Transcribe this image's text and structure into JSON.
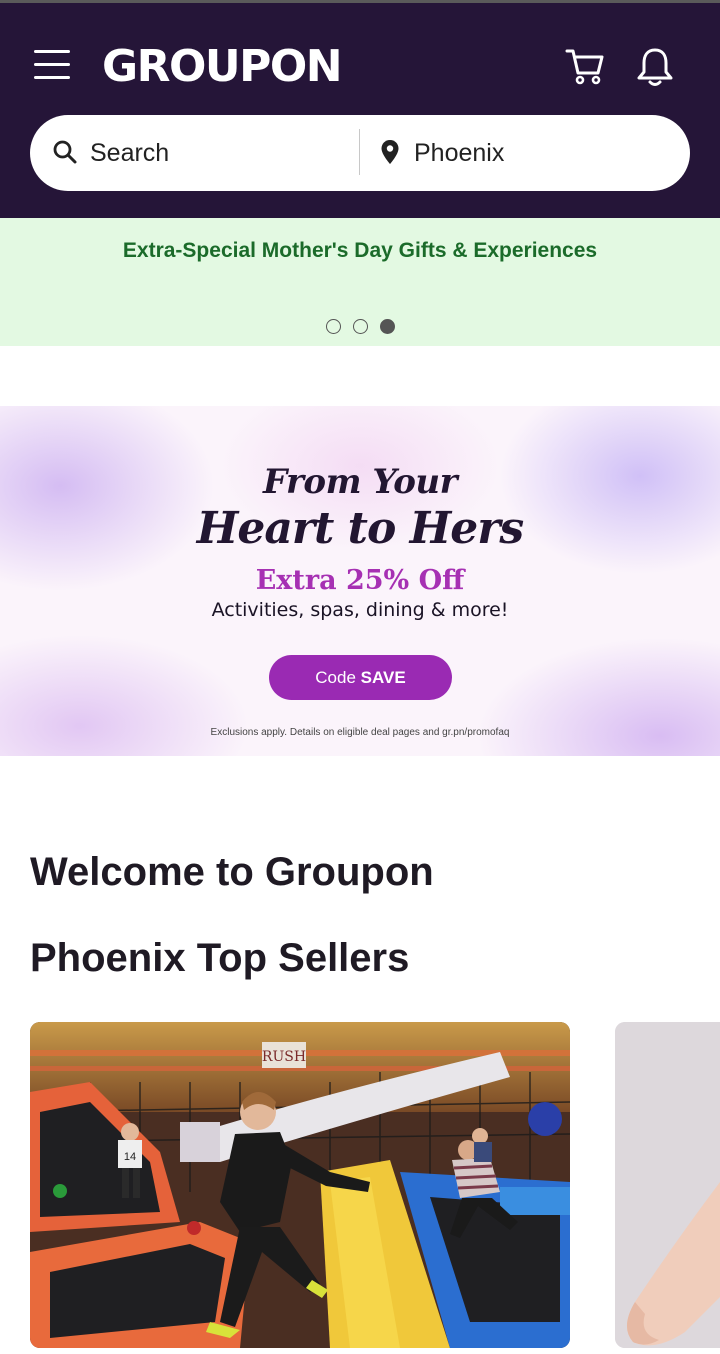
{
  "header": {
    "logo_text": "GROUPON",
    "menu_icon": "hamburger-menu-icon",
    "cart_icon": "shopping-cart-icon",
    "bell_icon": "notification-bell-icon",
    "colors": {
      "background": "#251538",
      "foreground": "#ffffff"
    }
  },
  "search": {
    "query_placeholder": "Search",
    "location_value": "Phoenix",
    "search_icon": "search-icon",
    "location_icon": "map-pin-icon"
  },
  "promo_strip": {
    "text": "Extra-Special Mother's Day Gifts & Experiences",
    "slide_count": 3,
    "active_slide": 3,
    "colors": {
      "background": "#e3f9e2",
      "text": "#1b6b2a"
    }
  },
  "banner": {
    "line1": "From Your",
    "line2": "Heart to Hers",
    "offer": "Extra 25% Off",
    "subtext": "Activities, spas, dining & more!",
    "code_prefix": "Code",
    "code": "SAVE",
    "fine_print": "Exclusions apply. Details on eligible deal pages and gr.pn/promofaq",
    "colors": {
      "accent": "#a630b3",
      "button": "#9a2ab3",
      "headline": "#221631"
    }
  },
  "main": {
    "welcome_heading": "Welcome to Groupon",
    "section_heading": "Phoenix Top Sellers",
    "cards": [
      {
        "image": "trampoline-park-photo"
      },
      {
        "image": "spa-treatment-photo"
      }
    ]
  }
}
